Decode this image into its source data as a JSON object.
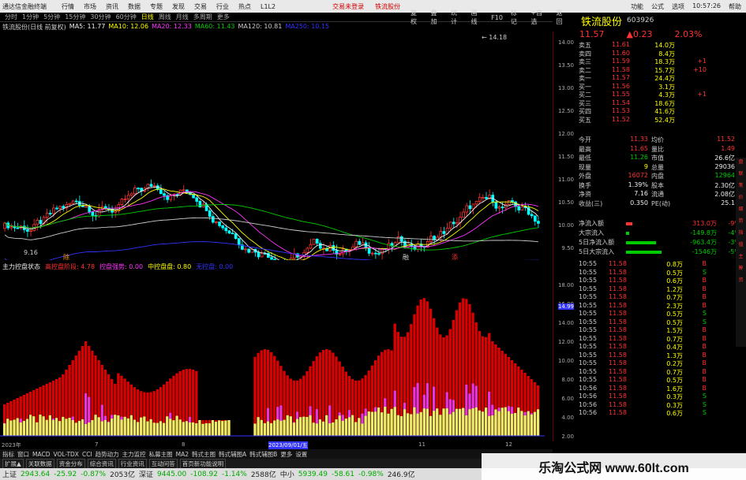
{
  "titlebar": {
    "app": "通达信金融终端",
    "menus": [
      "行情",
      "市场",
      "资讯",
      "数据",
      "专题",
      "发现",
      "交易",
      "行业",
      "热点",
      "L1L2"
    ],
    "center": [
      "交易未登录",
      "铁流股份"
    ],
    "right": [
      "功能",
      "公式",
      "选项",
      "10:57:26",
      "帮助"
    ]
  },
  "toolbar": {
    "periods": [
      "分时",
      "1分钟",
      "5分钟",
      "15分钟",
      "30分钟",
      "60分钟",
      "日线",
      "周线",
      "月线",
      "多周期",
      "更多"
    ],
    "active": "日线",
    "extra": [
      "复权",
      "叠加",
      "统计",
      "画线",
      "F10",
      "标记",
      "+自选",
      "返回"
    ]
  },
  "maline": {
    "title": "铁流股份(日线 前复权)",
    "items": [
      {
        "label": "MA5: 11.77",
        "color": "#eee"
      },
      {
        "label": "MA10: 12.06",
        "color": "#ff0"
      },
      {
        "label": "MA20: 12.33",
        "color": "#f3f"
      },
      {
        "label": "MA60: 11.43",
        "color": "#0c0"
      },
      {
        "label": "MA120: 10.81",
        "color": "#ccc"
      },
      {
        "label": "MA250: 10.15",
        "color": "#33f"
      }
    ]
  },
  "kchart": {
    "high_label": "14.18",
    "low_label": "9.16",
    "markers": [
      "除",
      "融",
      "添"
    ]
  },
  "lower": {
    "items": [
      {
        "label": "主力控盘状态",
        "color": "#eee"
      },
      {
        "label": "高控盘阶段: 4.78",
        "color": "#f33"
      },
      {
        "label": "控盘强势: 0.00",
        "color": "#f3f"
      },
      {
        "label": "中控盘盘: 0.80",
        "color": "#ff0"
      },
      {
        "label": "无控盘: 0.00",
        "color": "#33f"
      }
    ],
    "dates": [
      "2023年",
      "7",
      "8",
      "2023/09/01/五",
      "11",
      "12"
    ]
  },
  "axis": {
    "price": [
      "14.00",
      "13.50",
      "13.00",
      "12.50",
      "12.00",
      "11.50",
      "11.00",
      "10.50",
      "10.00",
      "9.50"
    ],
    "lower": [
      "18.00",
      "16.00",
      "14.00",
      "12.00",
      "10.00",
      "8.00",
      "6.00",
      "4.00",
      "2.00"
    ],
    "marker": "14.99"
  },
  "stock": {
    "name": "铁流股份",
    "code": "603926",
    "price": "11.57",
    "change": "▲0.23",
    "pct": "2.03%"
  },
  "orderbook": [
    {
      "lbl": "卖五",
      "px": "11.61",
      "vol": "14.0万",
      "chg": ""
    },
    {
      "lbl": "卖四",
      "px": "11.60",
      "vol": "8.4万",
      "chg": ""
    },
    {
      "lbl": "卖三",
      "px": "11.59",
      "vol": "18.3万",
      "chg": "+1"
    },
    {
      "lbl": "卖二",
      "px": "11.58",
      "vol": "15.7万",
      "chg": "+10"
    },
    {
      "lbl": "卖一",
      "px": "11.57",
      "vol": "24.4万",
      "chg": ""
    },
    {
      "lbl": "买一",
      "px": "11.56",
      "vol": "3.1万",
      "chg": ""
    },
    {
      "lbl": "买二",
      "px": "11.55",
      "vol": "4.3万",
      "chg": "+1"
    },
    {
      "lbl": "买三",
      "px": "11.54",
      "vol": "18.6万",
      "chg": ""
    },
    {
      "lbl": "买四",
      "px": "11.53",
      "vol": "41.6万",
      "chg": ""
    },
    {
      "lbl": "买五",
      "px": "11.52",
      "vol": "52.4万",
      "chg": ""
    }
  ],
  "quote": [
    {
      "a": "今开",
      "b": "11.33",
      "c": "均价",
      "d": "11.52"
    },
    {
      "a": "最高",
      "b": "11.65",
      "c": "量比",
      "d": "1.49"
    },
    {
      "a": "最低",
      "b": "11.26",
      "c": "市值",
      "d": "26.6亿"
    },
    {
      "a": "现量",
      "b": "9",
      "c": "总量",
      "d": "29036"
    },
    {
      "a": "外盘",
      "b": "16072",
      "c": "内盘",
      "d": "12964"
    },
    {
      "a": "换手",
      "b": "1.39%",
      "c": "股本",
      "d": "2.30亿"
    },
    {
      "a": "净资",
      "b": "7.16",
      "c": "流通",
      "d": "2.08亿"
    },
    {
      "a": "收益(三)",
      "b": "0.350",
      "c": "PE(动)",
      "d": "25.1"
    }
  ],
  "flows": [
    {
      "label": "净流入额",
      "value": "313.0万",
      "pct": "-9%",
      "color": "#f33"
    },
    {
      "label": "大宗流入",
      "value": "-149.8万",
      "pct": "-4%",
      "color": "#0c0"
    },
    {
      "label": "5日净流入额",
      "value": "-963.4万",
      "pct": "-3%",
      "color": "#0c0"
    },
    {
      "label": "5日大宗流入",
      "value": "-1546万",
      "pct": "-5%",
      "color": "#0c0"
    }
  ],
  "ticks": [
    {
      "t": "10:55",
      "p": "11.58",
      "v": "0.8万",
      "bs": "B"
    },
    {
      "t": "10:55",
      "p": "11.58",
      "v": "0.5万",
      "bs": "S"
    },
    {
      "t": "10:55",
      "p": "11.58",
      "v": "0.6万",
      "bs": "B"
    },
    {
      "t": "10:55",
      "p": "11.58",
      "v": "1.2万",
      "bs": "B"
    },
    {
      "t": "10:55",
      "p": "11.58",
      "v": "0.7万",
      "bs": "B"
    },
    {
      "t": "10:55",
      "p": "11.58",
      "v": "2.3万",
      "bs": "B"
    },
    {
      "t": "10:55",
      "p": "11.58",
      "v": "0.5万",
      "bs": "S"
    },
    {
      "t": "10:55",
      "p": "11.58",
      "v": "0.5万",
      "bs": "S"
    },
    {
      "t": "10:55",
      "p": "11.58",
      "v": "1.5万",
      "bs": "B"
    },
    {
      "t": "10:55",
      "p": "11.58",
      "v": "0.7万",
      "bs": "B"
    },
    {
      "t": "10:55",
      "p": "11.58",
      "v": "0.4万",
      "bs": "B"
    },
    {
      "t": "10:55",
      "p": "11.58",
      "v": "1.3万",
      "bs": "B"
    },
    {
      "t": "10:55",
      "p": "11.58",
      "v": "0.2万",
      "bs": "B"
    },
    {
      "t": "10:55",
      "p": "11.58",
      "v": "0.7万",
      "bs": "B"
    },
    {
      "t": "10:55",
      "p": "11.58",
      "v": "0.5万",
      "bs": "B"
    },
    {
      "t": "10:56",
      "p": "11.58",
      "v": "1.6万",
      "bs": "B"
    },
    {
      "t": "10:56",
      "p": "11.58",
      "v": "0.3万",
      "bs": "S"
    },
    {
      "t": "10:56",
      "p": "11.58",
      "v": "0.3万",
      "bs": "S"
    },
    {
      "t": "10:56",
      "p": "11.58",
      "v": "0.6万",
      "bs": "S"
    }
  ],
  "sidetabs": [
    "盘",
    "联",
    "笔",
    "价",
    "细",
    "势",
    "指",
    "值",
    "主",
    "筹",
    "资"
  ],
  "indtabs": [
    "指标",
    "窗口",
    "MACD",
    "VOL-TDX",
    "CCI",
    "趋势动力",
    "主力监控",
    "私募主图",
    "MA2",
    "韩式主图",
    "韩式辅图A",
    "韩式辅图B",
    "更多",
    "设置"
  ],
  "bottomtabs": [
    "扩展▲",
    "关联数据",
    "资金分布",
    "综合资讯",
    "行业资讯",
    "互动问答",
    "首页新功能说明"
  ],
  "status": [
    {
      "t": "上证",
      "c": "#222"
    },
    {
      "t": "2943.64",
      "c": "#0a0"
    },
    {
      "t": "-25.92",
      "c": "#0a0"
    },
    {
      "t": "-0.87%",
      "c": "#0a0"
    },
    {
      "t": "2053亿",
      "c": "#222"
    },
    {
      "t": "深证",
      "c": "#222"
    },
    {
      "t": "9445.00",
      "c": "#0a0"
    },
    {
      "t": "-108.92",
      "c": "#0a0"
    },
    {
      "t": "-1.14%",
      "c": "#0a0"
    },
    {
      "t": "2588亿",
      "c": "#222"
    },
    {
      "t": "中小",
      "c": "#222"
    },
    {
      "t": "5939.49",
      "c": "#0a0"
    },
    {
      "t": "-58.61",
      "c": "#0a0"
    },
    {
      "t": "-0.98%",
      "c": "#0a0"
    },
    {
      "t": "246.9亿",
      "c": "#222"
    }
  ],
  "watermark": "乐淘公式网 www.60lt.com"
}
